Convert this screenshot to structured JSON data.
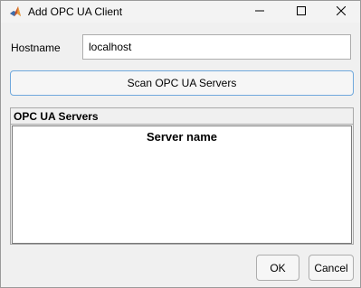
{
  "window": {
    "title": "Add OPC UA Client",
    "controls": [
      "minimize",
      "maximize",
      "close"
    ]
  },
  "form": {
    "hostname_label": "Hostname",
    "hostname_value": "localhost",
    "scan_button": "Scan OPC UA Servers"
  },
  "servers_panel": {
    "title": "OPC UA Servers",
    "columns": [
      "Server name"
    ],
    "rows": []
  },
  "footer": {
    "ok_label": "OK",
    "cancel_label": "Cancel"
  },
  "colors": {
    "accent_border": "#6fa8dc",
    "background": "#f0f0f0"
  }
}
